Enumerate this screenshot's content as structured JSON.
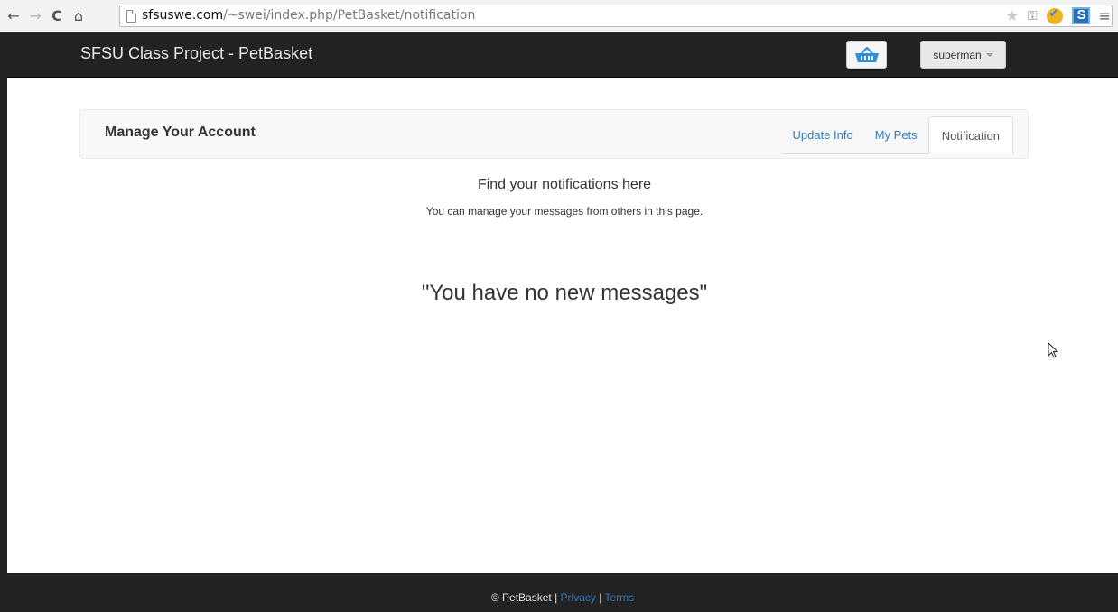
{
  "browser": {
    "url_host": "sfsuswe.com",
    "url_path": "/~swei/index.php/PetBasket/notification",
    "icons": [
      "back-icon",
      "forward-icon",
      "reload-icon",
      "home-icon",
      "page-icon",
      "star-icon",
      "key-icon",
      "extension-check-icon",
      "extension-s-icon",
      "menu-icon"
    ]
  },
  "navbar": {
    "brand": "SFSU Class Project - PetBasket",
    "user_label": "superman",
    "basket_icon": "basket-icon",
    "colors": {
      "bar": "#222222",
      "basket": "#2a8fe0"
    }
  },
  "account": {
    "title": "Manage Your Account",
    "tabs": [
      {
        "label": "Update Info",
        "active": false
      },
      {
        "label": "My Pets",
        "active": false
      },
      {
        "label": "Notification",
        "active": true
      }
    ]
  },
  "main": {
    "heading": "Find your notifications here",
    "subheading": "You can manage your messages from others in this page.",
    "empty_message": "\"You have no new messages\""
  },
  "footer": {
    "copyright": "© PetBasket",
    "sep1": "|",
    "privacy": "Privacy",
    "sep2": "|",
    "terms": "Terms",
    "link_color": "#337ab7"
  }
}
